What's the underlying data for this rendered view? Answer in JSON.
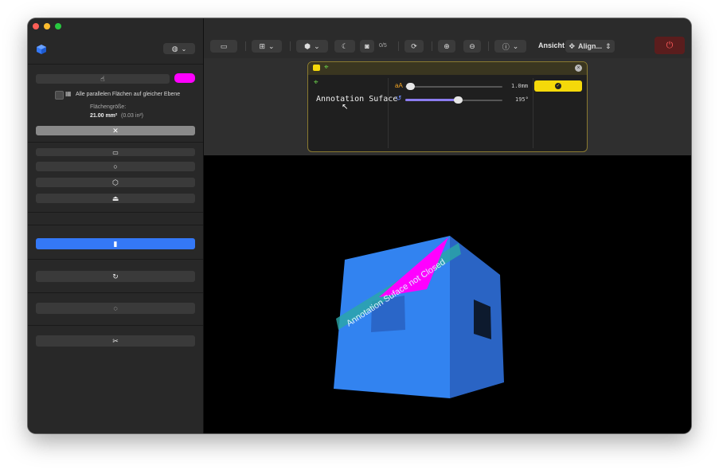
{
  "sidebar": {
    "language_button": "🌐 ⌄",
    "parallel_checkbox_label": "Alle parallelen Flächen auf gleicher Ebene",
    "area_label": "Flächengröße:",
    "area_value": "21.00 mm²",
    "area_value_alt": "(0.03 in²)",
    "clear_button": "✕",
    "highlight_color": "#ff00ff"
  },
  "toolbar": {
    "counter": "0/5",
    "view_label": "Ansicht",
    "align_label": "Align..."
  },
  "annotation": {
    "text": "Annotation Suface",
    "size_prefix": "aA",
    "size_value": "1.0mm",
    "size_fraction": 0.05,
    "rotation_value": "195°",
    "rotation_fraction": 0.54
  },
  "viewport": {
    "label_on_model": "Annotation Suface not Closed",
    "model_color": "#2f7be8"
  }
}
